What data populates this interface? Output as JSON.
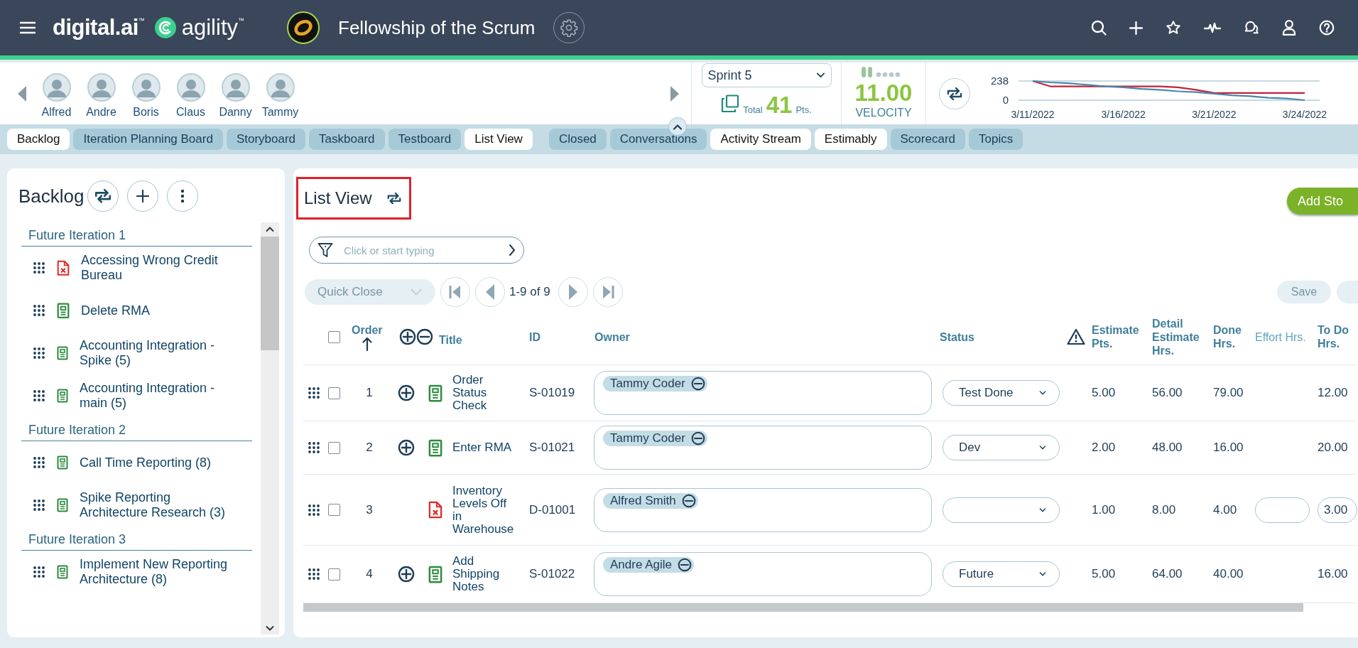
{
  "header": {
    "logo": "digital.ai",
    "logo_mark": "™",
    "product": "agility",
    "product_mark": "™",
    "team_name": "Fellowship of the Scrum"
  },
  "team": {
    "members": [
      {
        "name": "Alfred"
      },
      {
        "name": "Andre"
      },
      {
        "name": "Boris"
      },
      {
        "name": "Claus"
      },
      {
        "name": "Danny"
      },
      {
        "name": "Tammy"
      }
    ]
  },
  "sprint": {
    "value": "Sprint 5",
    "total_label": "Total",
    "total": "41",
    "total_unit": "Pts.",
    "velocity": "11.00",
    "velocity_label": "VELOCITY"
  },
  "burndown": {
    "chart_data": {
      "type": "line",
      "categories": [
        "3/11/2022",
        null,
        null,
        null,
        null,
        "3/16/2022",
        null,
        null,
        null,
        null,
        "3/21/2022",
        null,
        null,
        null,
        null,
        "3/24/2022"
      ],
      "yticks": [
        0,
        238
      ],
      "ylim": [
        0,
        238
      ],
      "series": [
        {
          "color": "#c0243c",
          "values": [
            238,
            170,
            170,
            170,
            170,
            170,
            170,
            170,
            160,
            130,
            90,
            90,
            90,
            90,
            90,
            90
          ]
        },
        {
          "color": "#4a86a8",
          "values": [
            238,
            220,
            210,
            190,
            170,
            160,
            140,
            130,
            110,
            100,
            80,
            60,
            50,
            30,
            20,
            0
          ]
        }
      ]
    }
  },
  "tabs": [
    {
      "label": "Backlog",
      "selected": true
    },
    {
      "label": "Iteration Planning Board",
      "selected": false
    },
    {
      "label": "Storyboard",
      "selected": false
    },
    {
      "label": "Taskboard",
      "selected": false
    },
    {
      "label": "Testboard",
      "selected": false
    },
    {
      "label": "List View",
      "selected": true
    },
    {
      "label": "Closed",
      "selected": false
    },
    {
      "label": "Conversations",
      "selected": false
    },
    {
      "label": "Activity Stream",
      "selected": true
    },
    {
      "label": "Estimably",
      "selected": true
    },
    {
      "label": "Scorecard",
      "selected": false
    },
    {
      "label": "Topics",
      "selected": false
    }
  ],
  "backlog": {
    "title": "Backlog",
    "groups": [
      {
        "name": "Future Iteration 1",
        "items": [
          {
            "title": "Accessing Wrong Credit Bureau",
            "kind": "defect"
          },
          {
            "title": "Delete RMA",
            "kind": "story"
          },
          {
            "title": "Accounting Integration - Spike (5)",
            "kind": "story"
          },
          {
            "title": "Accounting Integration - main (5)",
            "kind": "story"
          }
        ]
      },
      {
        "name": "Future Iteration 2",
        "items": [
          {
            "title": "Call Time Reporting (8)",
            "kind": "story"
          },
          {
            "title": "Spike Reporting Architecture Research (3)",
            "kind": "story"
          }
        ]
      },
      {
        "name": "Future Iteration 3",
        "items": [
          {
            "title": "Implement New Reporting Architecture (8)",
            "kind": "story"
          }
        ]
      }
    ]
  },
  "list_view": {
    "title": "List View",
    "add_button": "Add Sto",
    "filter": {
      "placeholder": "Click or start typing"
    },
    "quick_close": {
      "label": "Quick Close",
      "disabled": true
    },
    "paging": "1-9 of 9",
    "save_button": {
      "label": "Save",
      "disabled": true
    },
    "all_checked": false,
    "columns": [
      "Order",
      "Title",
      "ID",
      "Owner",
      "Status",
      "Estimate Pts.",
      "Detail Estimate Hrs.",
      "Done Hrs.",
      "Effort Hrs.",
      "To Do Hrs."
    ],
    "rows": [
      {
        "order": "1",
        "kind": "story",
        "checked": false,
        "title": "Order Status Check",
        "id": "S-01019",
        "owner": "Tammy Coder",
        "status": "Test Done",
        "estimate": "5.00",
        "detail_estimate": "56.00",
        "done": "79.00",
        "to_do": "12.00",
        "editing": false
      },
      {
        "order": "2",
        "kind": "story",
        "checked": false,
        "title": "Enter RMA",
        "id": "S-01021",
        "owner": "Tammy Coder",
        "status": "Dev",
        "estimate": "2.00",
        "detail_estimate": "48.00",
        "done": "16.00",
        "to_do": "20.00",
        "editing": false
      },
      {
        "order": "3",
        "kind": "defect",
        "checked": false,
        "title": "Inventory Levels Off in Warehouse",
        "id": "D-01001",
        "owner": "Alfred Smith",
        "estimate": "1.00",
        "detail_estimate": "8.00",
        "done": "4.00",
        "to_do": "3.00",
        "editing": true
      },
      {
        "order": "4",
        "kind": "story",
        "checked": false,
        "title": "Add Shipping Notes",
        "id": "S-01022",
        "owner": "Andre Agile",
        "status": "Future",
        "estimate": "5.00",
        "detail_estimate": "64.00",
        "done": "40.00",
        "to_do": "16.00",
        "editing": false
      }
    ]
  }
}
